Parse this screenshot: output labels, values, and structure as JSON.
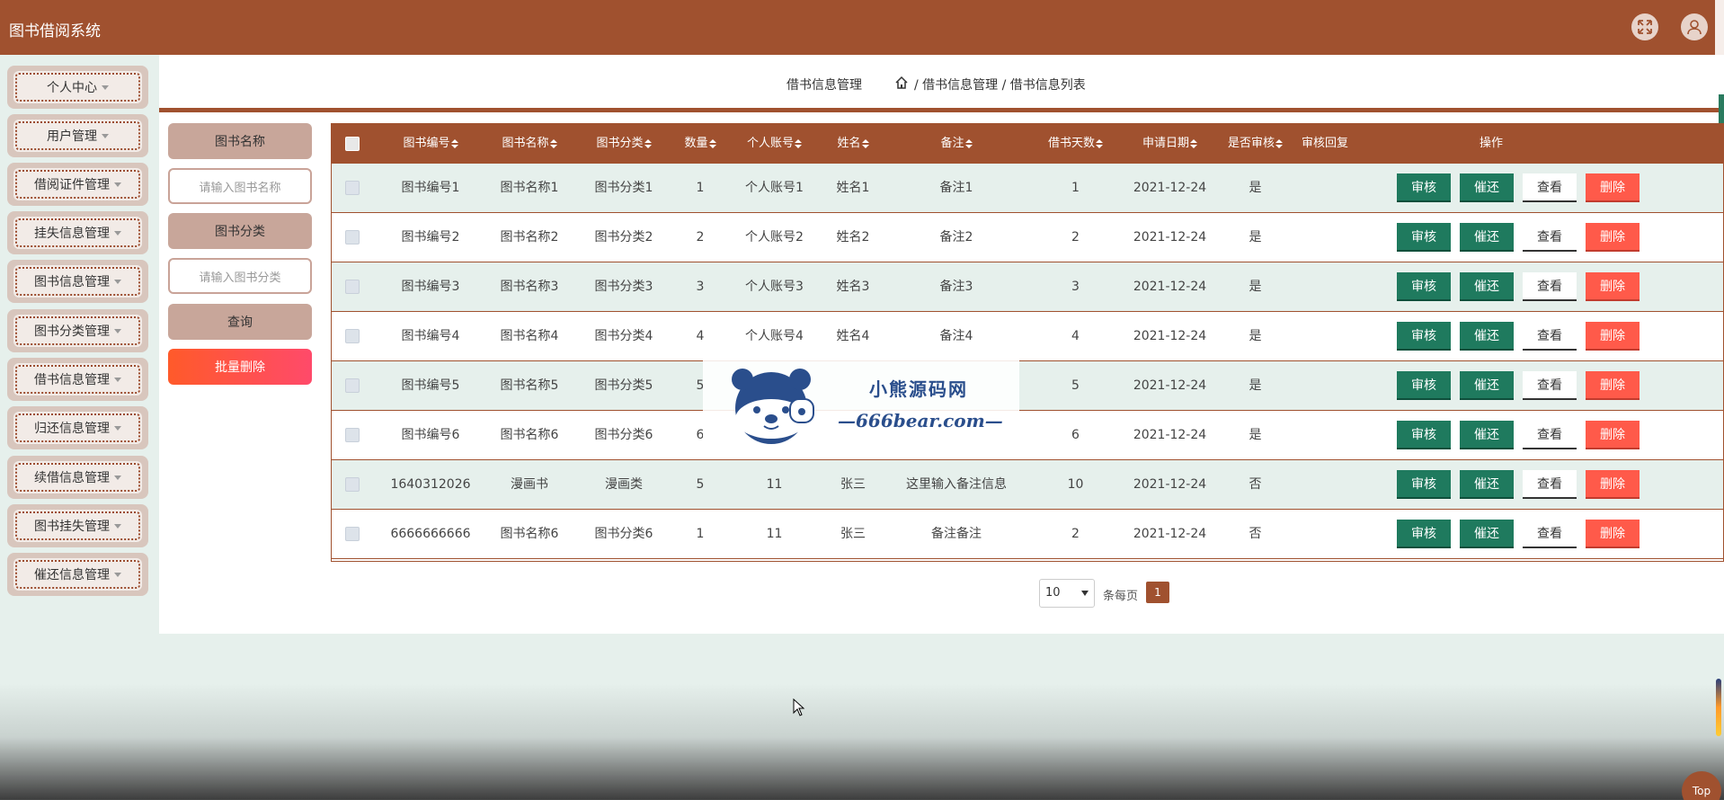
{
  "app": {
    "title": "图书借阅系统"
  },
  "topbar": {
    "fullscreen_icon": "fullscreen-icon",
    "user_icon": "user-avatar-icon"
  },
  "sidebar": {
    "items": [
      {
        "label": "个人中心"
      },
      {
        "label": "用户管理"
      },
      {
        "label": "借阅证件管理"
      },
      {
        "label": "挂失信息管理"
      },
      {
        "label": "图书信息管理"
      },
      {
        "label": "图书分类管理"
      },
      {
        "label": "借书信息管理"
      },
      {
        "label": "归还信息管理"
      },
      {
        "label": "续借信息管理"
      },
      {
        "label": "图书挂失管理"
      },
      {
        "label": "催还信息管理"
      }
    ]
  },
  "breadcrumb": {
    "title": "借书信息管理",
    "path": "/ 借书信息管理 / 借书信息列表"
  },
  "filters": {
    "book_name_label": "图书名称",
    "book_name_placeholder": "请输入图书名称",
    "book_category_label": "图书分类",
    "book_category_placeholder": "请输入图书分类",
    "query_label": "查询",
    "batch_delete_label": "批量删除"
  },
  "table": {
    "headers": [
      "图书编号",
      "图书名称",
      "图书分类",
      "数量",
      "个人账号",
      "姓名",
      "备注",
      "借书天数",
      "申请日期",
      "是否审核",
      "审核回复",
      "操作"
    ],
    "rows": [
      {
        "code": "图书编号1",
        "name": "图书名称1",
        "category": "图书分类1",
        "qty": "1",
        "account": "个人账号1",
        "person": "姓名1",
        "remark": "备注1",
        "days": "1",
        "date": "2021-12-24",
        "audited": "是",
        "reply": ""
      },
      {
        "code": "图书编号2",
        "name": "图书名称2",
        "category": "图书分类2",
        "qty": "2",
        "account": "个人账号2",
        "person": "姓名2",
        "remark": "备注2",
        "days": "2",
        "date": "2021-12-24",
        "audited": "是",
        "reply": ""
      },
      {
        "code": "图书编号3",
        "name": "图书名称3",
        "category": "图书分类3",
        "qty": "3",
        "account": "个人账号3",
        "person": "姓名3",
        "remark": "备注3",
        "days": "3",
        "date": "2021-12-24",
        "audited": "是",
        "reply": ""
      },
      {
        "code": "图书编号4",
        "name": "图书名称4",
        "category": "图书分类4",
        "qty": "4",
        "account": "个人账号4",
        "person": "姓名4",
        "remark": "备注4",
        "days": "4",
        "date": "2021-12-24",
        "audited": "是",
        "reply": ""
      },
      {
        "code": "图书编号5",
        "name": "图书名称5",
        "category": "图书分类5",
        "qty": "5",
        "account": "",
        "person": "",
        "remark": "",
        "days": "5",
        "date": "2021-12-24",
        "audited": "是",
        "reply": ""
      },
      {
        "code": "图书编号6",
        "name": "图书名称6",
        "category": "图书分类6",
        "qty": "6",
        "account": "",
        "person": "",
        "remark": "",
        "days": "6",
        "date": "2021-12-24",
        "audited": "是",
        "reply": ""
      },
      {
        "code": "1640312026",
        "name": "漫画书",
        "category": "漫画类",
        "qty": "5",
        "account": "11",
        "person": "张三",
        "remark": "这里输入备注信息",
        "days": "10",
        "date": "2021-12-24",
        "audited": "否",
        "reply": ""
      },
      {
        "code": "6666666666",
        "name": "图书名称6",
        "category": "图书分类6",
        "qty": "1",
        "account": "11",
        "person": "张三",
        "remark": "备注备注",
        "days": "2",
        "date": "2021-12-24",
        "audited": "否",
        "reply": ""
      }
    ],
    "actions": {
      "audit": "审核",
      "remind": "催还",
      "view": "查看",
      "delete": "删除"
    }
  },
  "pagination": {
    "page_size": "10",
    "per_page_label": "条每页",
    "current_page": "1"
  },
  "watermark": {
    "cn": "小熊源码网",
    "en": "—666bear.com—"
  },
  "scroll_top_label": "Top",
  "colors": {
    "primary": "#a0512f",
    "row_alt": "#e6f0ec",
    "green": "#1f7a5e",
    "red": "#ff5a4a"
  }
}
